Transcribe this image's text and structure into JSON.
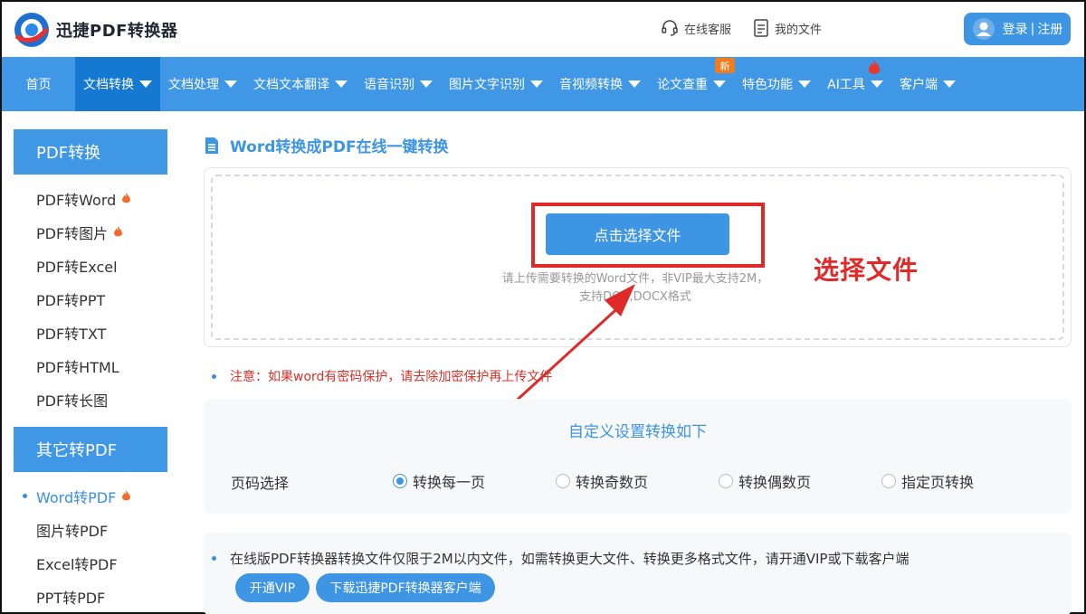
{
  "header": {
    "brand": "迅捷PDF转换器",
    "service_label": "在线客服",
    "files_label": "我的文件",
    "login_label": "登录",
    "login_sep": "|",
    "register_label": "注册"
  },
  "nav": {
    "items": [
      {
        "label": "首页",
        "has_caret": false
      },
      {
        "label": "文档转换",
        "has_caret": true
      },
      {
        "label": "文档处理",
        "has_caret": true
      },
      {
        "label": "文档文本翻译",
        "has_caret": true
      },
      {
        "label": "语音识别",
        "has_caret": true
      },
      {
        "label": "图片文字识别",
        "has_caret": true
      },
      {
        "label": "音视频转换",
        "has_caret": true
      },
      {
        "label": "论文查重",
        "has_caret": true
      },
      {
        "label": "特色功能",
        "has_caret": true
      },
      {
        "label": "AI工具",
        "has_caret": true
      },
      {
        "label": "客户端",
        "has_caret": true
      }
    ],
    "new_badge": "新"
  },
  "sidebar": {
    "section1_title": "PDF转换",
    "section1_items": [
      "PDF转Word",
      "PDF转图片",
      "PDF转Excel",
      "PDF转PPT",
      "PDF转TXT",
      "PDF转HTML",
      "PDF转长图"
    ],
    "section2_title": "其它转PDF",
    "section2_items": [
      "Word转PDF",
      "图片转PDF",
      "Excel转PDF",
      "PPT转PDF"
    ]
  },
  "main": {
    "title": "Word转换成PDF在线一键转换",
    "choose_button": "点击选择文件",
    "hint_line1": "请上传需要转换的Word文件，非VIP最大支持2M，",
    "hint_line2": "支持DOC,DOCX格式",
    "annotation": "选择文件",
    "notice": "注意：如果word有密码保护，请去除加密保护再上传文件",
    "settings_title": "自定义设置转换如下",
    "page_label": "页码选择",
    "radio_options": [
      "转换每一页",
      "转换奇数页",
      "转换偶数页",
      "指定页转换"
    ],
    "selected_option": "转换每一页",
    "bottom_text": "在线版PDF转换器转换文件仅限于2M以内文件，如需转换更大文件、转换更多格式文件，请开通VIP或下载客户端",
    "vip_button": "开通VIP",
    "download_button": "下载迅捷PDF转换器客户端"
  },
  "colors": {
    "primary": "#3f97e6",
    "nav_active": "#1579d2",
    "annotation_red": "#e02a2a",
    "notice_red": "#d9302a",
    "badge_orange": "#f07c1b"
  }
}
